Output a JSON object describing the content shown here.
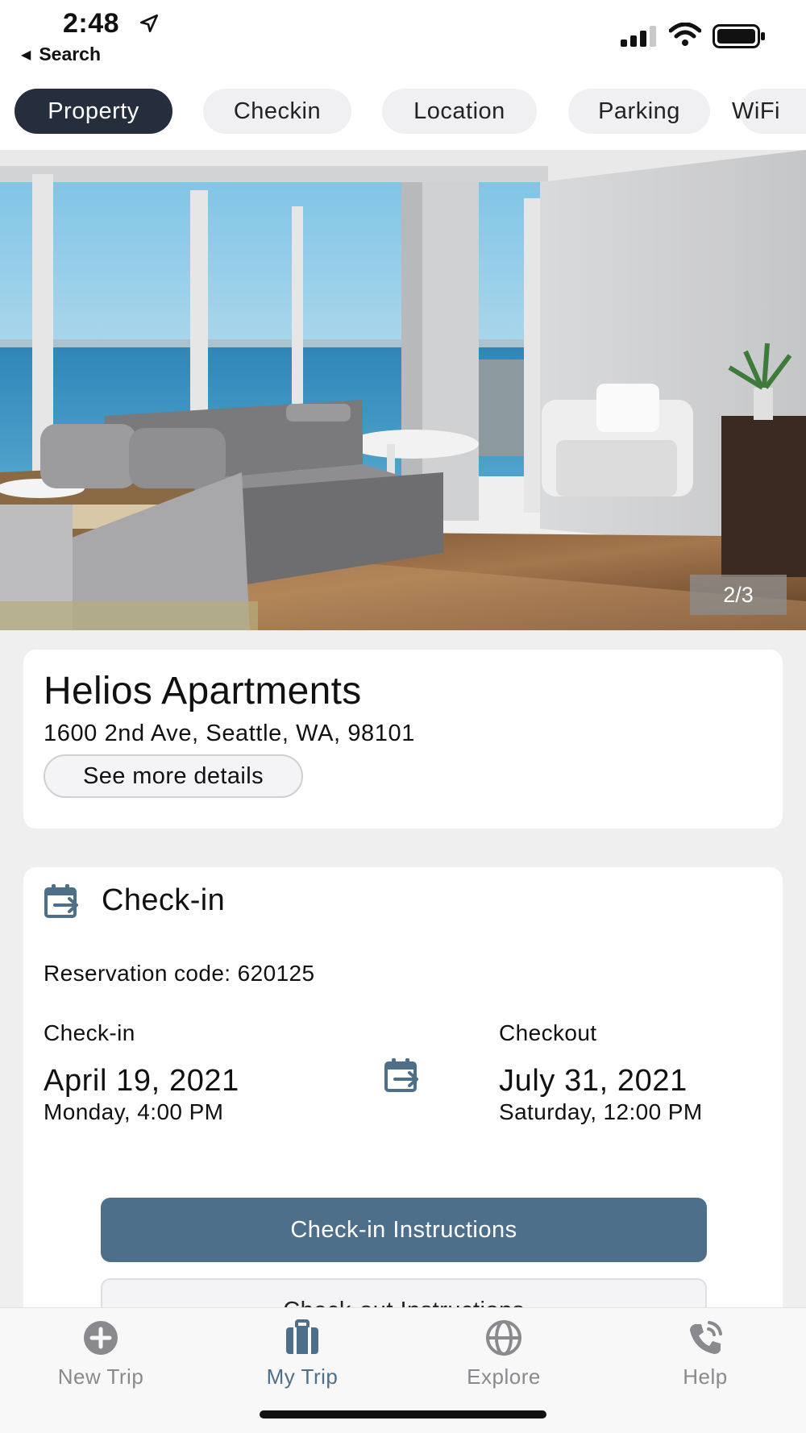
{
  "status_bar": {
    "time": "2:48",
    "back_label": "Search"
  },
  "tabs": [
    {
      "label": "Property",
      "active": true
    },
    {
      "label": "Checkin",
      "active": false
    },
    {
      "label": "Location",
      "active": false
    },
    {
      "label": "Parking",
      "active": false
    },
    {
      "label": "WiFi",
      "active": false
    }
  ],
  "gallery": {
    "counter": "2/3"
  },
  "property": {
    "name": "Helios Apartments",
    "address": "1600 2nd Ave, Seattle, WA, 98101",
    "details_button": "See more details"
  },
  "checkin_section": {
    "title": "Check-in",
    "reservation_code": "Reservation code: 620125",
    "checkin": {
      "label": "Check-in",
      "date": "April 19, 2021",
      "day_time": "Monday,  4:00 PM"
    },
    "checkout": {
      "label": "Checkout",
      "date": "July 31, 2021",
      "day_time": "Saturday,  12:00 PM"
    },
    "checkin_instructions_button": "Check-in Instructions",
    "checkout_instructions_button": "Check-out Instructions"
  },
  "bottom_nav": [
    {
      "label": "New Trip",
      "icon": "plus-circle-icon",
      "active": false
    },
    {
      "label": "My Trip",
      "icon": "luggage-icon",
      "active": true
    },
    {
      "label": "Explore",
      "icon": "globe-icon",
      "active": false
    },
    {
      "label": "Help",
      "icon": "phone-icon",
      "active": false
    }
  ],
  "colors": {
    "accent": "#4e6f8a",
    "active_tab": "#262e3d",
    "inactive_nav": "#8a8a8e"
  }
}
